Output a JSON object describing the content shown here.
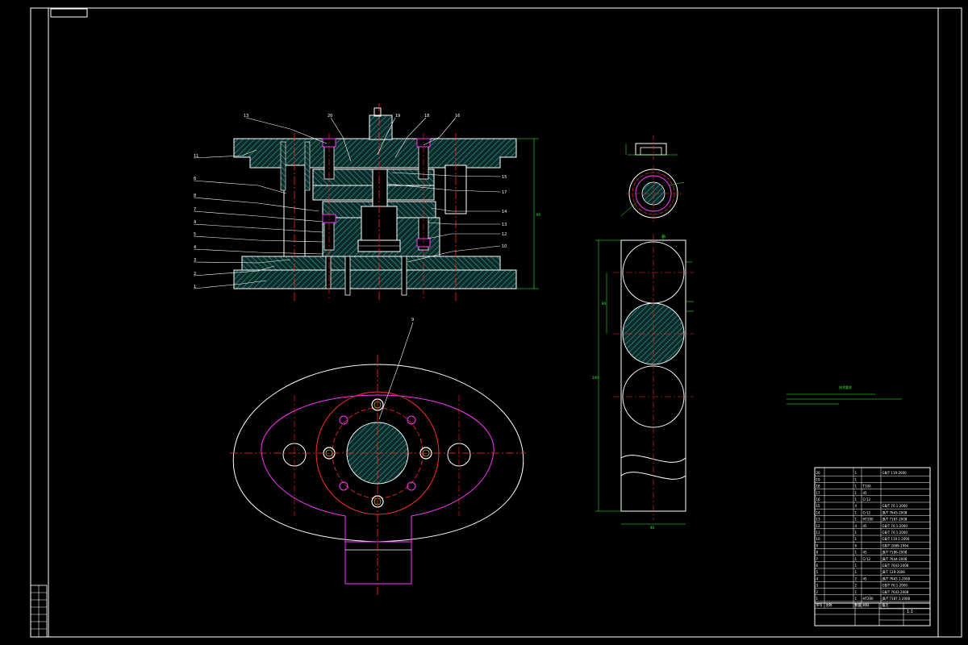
{
  "sheet": {
    "stamp_label": "",
    "colors": {
      "background": "#000000",
      "outline": "#ffffff",
      "hatch": "#2fa7a0",
      "centerline": "#ff2a2a",
      "dimension": "#33ff33",
      "magenta": "#ff33ff",
      "yellow": "#ffff33"
    }
  },
  "section_view": {
    "leader_numbers_left": [
      "11",
      "6",
      "8",
      "7",
      "4",
      "5",
      "4",
      "3",
      "2",
      "1"
    ],
    "leader_numbers_top": [
      "13",
      "20",
      "19",
      "18",
      "16"
    ],
    "leader_numbers_right": [
      "15",
      "17",
      "14",
      "13",
      "12",
      "10"
    ],
    "height_dim": "95"
  },
  "plan_view": {
    "leader_number": "9"
  },
  "blank_view": {
    "dims": [
      "46",
      "",
      "",
      "84",
      "100",
      "40"
    ]
  },
  "tech_notes": {
    "title": "技术要求",
    "lines": [
      "",
      "",
      ""
    ]
  },
  "title_block": {
    "rows": [
      {
        "no": "20",
        "name": "",
        "qty": "1",
        "mat": "",
        "std": "GB/T 119-2000"
      },
      {
        "no": "19",
        "name": "",
        "qty": "1",
        "mat": "",
        "std": ""
      },
      {
        "no": "18",
        "name": "",
        "qty": "1",
        "mat": "T10A",
        "std": ""
      },
      {
        "no": "17",
        "name": "",
        "qty": "1",
        "mat": "45",
        "std": ""
      },
      {
        "no": "16",
        "name": "",
        "qty": "1",
        "mat": "Cr12",
        "std": ""
      },
      {
        "no": "15",
        "name": "",
        "qty": "4",
        "mat": "",
        "std": "GB/T 70.1-2000"
      },
      {
        "no": "14",
        "name": "",
        "qty": "1",
        "mat": "Cr12",
        "std": "JB/T 7643-2008"
      },
      {
        "no": "13",
        "name": "",
        "qty": "1",
        "mat": "HT200",
        "std": "JB/T 7187-2008"
      },
      {
        "no": "12",
        "name": "",
        "qty": "4",
        "mat": "45",
        "std": "GB/T 70.1-2000"
      },
      {
        "no": "11",
        "name": "",
        "qty": "1",
        "mat": "",
        "std": "GB/T 70.1-2000"
      },
      {
        "no": "10",
        "name": "",
        "qty": "1",
        "mat": "",
        "std": "GB/T 119.1-2000"
      },
      {
        "no": "9",
        "name": "",
        "qty": "6",
        "mat": "",
        "std": "GB/T 2089-1994"
      },
      {
        "no": "8",
        "name": "",
        "qty": "1",
        "mat": "45",
        "std": "JB/T 7186-2008"
      },
      {
        "no": "7",
        "name": "",
        "qty": "1",
        "mat": "Cr12",
        "std": "JB/T 7644-2008"
      },
      {
        "no": "6",
        "name": "",
        "qty": "1",
        "mat": "",
        "std": "GB/T 7643-2008"
      },
      {
        "no": "5",
        "name": "",
        "qty": "1",
        "mat": "",
        "std": "JB/T 129-2008"
      },
      {
        "no": "4",
        "name": "",
        "qty": "2",
        "mat": "45",
        "std": "JB/T 7643.1-2008"
      },
      {
        "no": "3",
        "name": "",
        "qty": "2",
        "mat": "",
        "std": "GB/T 70.1-2000"
      },
      {
        "no": "2",
        "name": "",
        "qty": "1",
        "mat": "",
        "std": "GB/T 7643-2008"
      },
      {
        "no": "1",
        "name": "",
        "qty": "1",
        "mat": "HT200",
        "std": "JB/T 7187.1-2008"
      }
    ],
    "header": {
      "no": "序号",
      "name": "名称",
      "qty": "数量",
      "mat": "材料",
      "std": "备注"
    },
    "drawing_title": "",
    "scale": "1:1",
    "sheet_no": ""
  },
  "revision_block": {
    "cells": [
      "",
      "",
      "",
      "",
      "",
      "",
      ""
    ]
  }
}
